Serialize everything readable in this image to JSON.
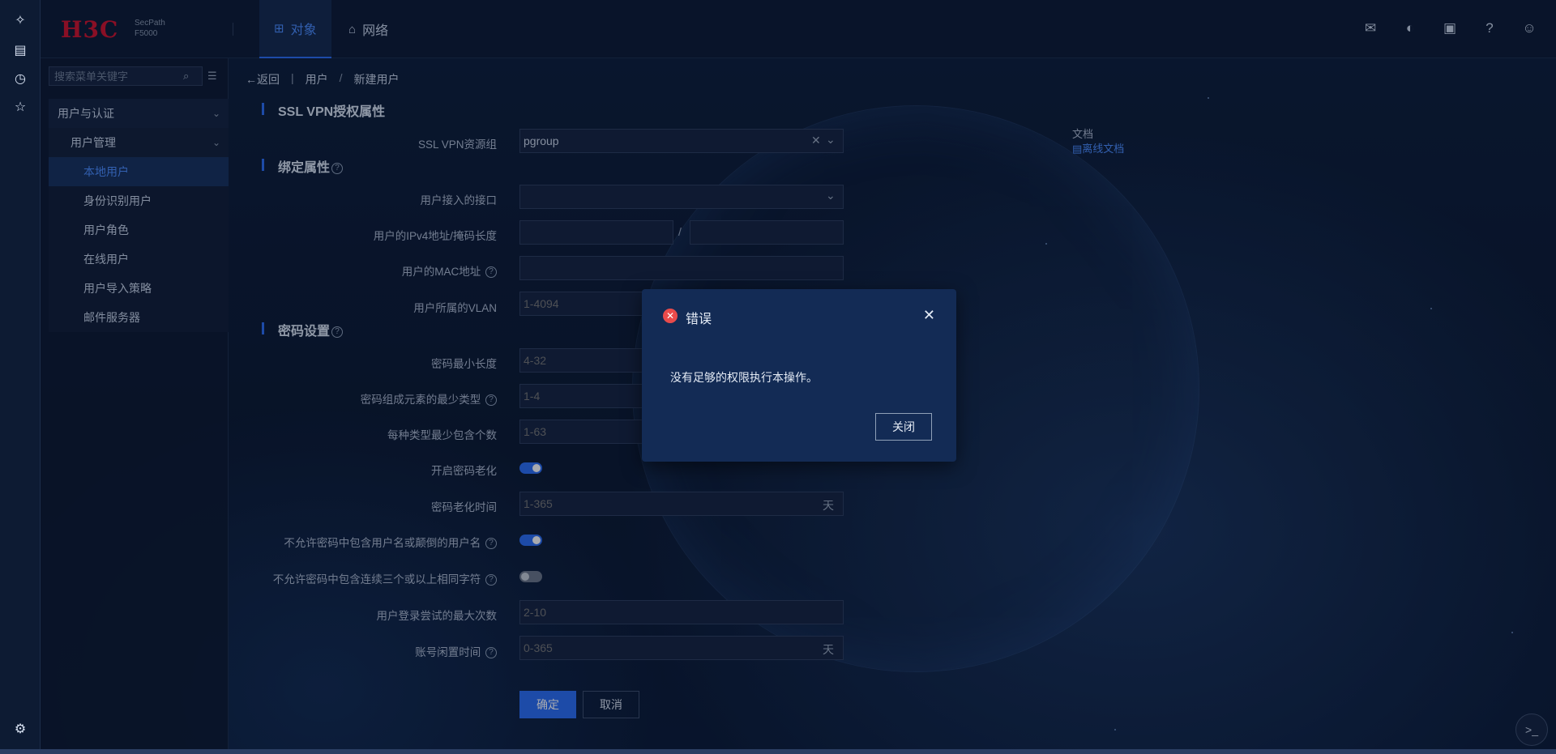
{
  "brand": {
    "logo": "H3C",
    "product_line1": "SecPath",
    "product_line2": "F5000"
  },
  "nav": {
    "tabs": [
      {
        "label": "对象",
        "icon": "grid-icon",
        "active": true
      },
      {
        "label": "网络",
        "icon": "router-icon",
        "active": false
      }
    ]
  },
  "header_icons": [
    "inbox-icon",
    "palette-icon",
    "save-icon",
    "help-icon",
    "user-icon"
  ],
  "rail_icons": [
    "sparkle-icon",
    "network-icon",
    "clock-icon",
    "star-icon",
    "settings-icon"
  ],
  "sidebar": {
    "search_placeholder": "搜索菜单关键字",
    "items": [
      {
        "label": "用户与认证",
        "level": 1
      },
      {
        "label": "用户管理",
        "level": 2
      },
      {
        "label": "本地用户",
        "level": 3,
        "active": true
      },
      {
        "label": "身份识别用户",
        "level": 3
      },
      {
        "label": "用户角色",
        "level": 3
      },
      {
        "label": "在线用户",
        "level": 3
      },
      {
        "label": "用户导入策略",
        "level": 3
      },
      {
        "label": "邮件服务器",
        "level": 3
      }
    ]
  },
  "breadcrumb": {
    "back": "返回",
    "parent": "用户",
    "sep": "/",
    "current": "新建用户"
  },
  "doc": {
    "label": "文档",
    "link": "离线文档"
  },
  "form": {
    "section_sslvpn": "SSL VPN授权属性",
    "sslvpn_group_label": "SSL VPN资源组",
    "sslvpn_group_value": "pgroup",
    "section_bind": "绑定属性",
    "iface_label": "用户接入的接口",
    "ipv4_label": "用户的IPv4地址/掩码长度",
    "ipv4_sep": "/",
    "mac_label": "用户的MAC地址",
    "vlan_label": "用户所属的VLAN",
    "vlan_placeholder": "1-4094",
    "section_pwd": "密码设置",
    "pwd_min_len_label": "密码最小长度",
    "pwd_min_len_placeholder": "4-32",
    "pwd_min_types_label": "密码组成元素的最少类型",
    "pwd_min_types_placeholder": "1-4",
    "pwd_per_type_label": "每种类型最少包含个数",
    "pwd_per_type_placeholder": "1-63",
    "pwd_aging_label": "开启密码老化",
    "pwd_aging_on": true,
    "pwd_aging_time_label": "密码老化时间",
    "pwd_aging_time_placeholder": "1-365",
    "unit_day": "天",
    "no_username_label": "不允许密码中包含用户名或颠倒的用户名",
    "no_username_on": true,
    "no_repeat_label": "不允许密码中包含连续三个或以上相同字符",
    "no_repeat_on": false,
    "max_login_label": "用户登录尝试的最大次数",
    "max_login_placeholder": "2-10",
    "idle_label": "账号闲置时间",
    "idle_placeholder": "0-365",
    "ok": "确定",
    "cancel": "取消"
  },
  "modal": {
    "title": "错误",
    "message": "没有足够的权限执行本操作。",
    "close_button": "关闭"
  },
  "colors": {
    "accent": "#2a6df4",
    "error": "#e94b4b",
    "brand": "#d0122b"
  }
}
